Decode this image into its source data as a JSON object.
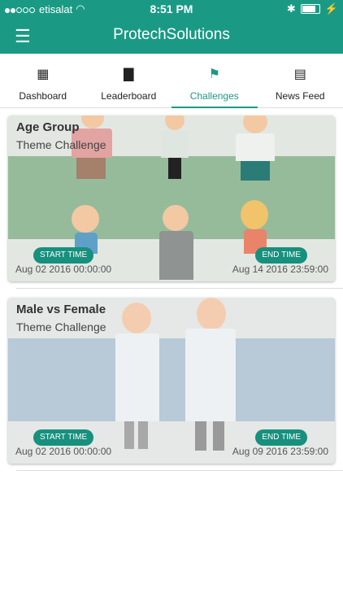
{
  "status_bar": {
    "carrier": "etisalat",
    "time": "8:51 PM"
  },
  "app": {
    "title": "ProtechSolutions"
  },
  "tabs": [
    {
      "label": "Dashboard",
      "icon": "grid-icon"
    },
    {
      "label": "Leaderboard",
      "icon": "bar-chart-icon"
    },
    {
      "label": "Challenges",
      "icon": "flag-icon"
    },
    {
      "label": "News Feed",
      "icon": "newspaper-icon"
    }
  ],
  "challenges": [
    {
      "title": "Age Group",
      "subtitle": "Theme Challenge",
      "start_label": "START TIME",
      "end_label": "END TIME",
      "start_date": "Aug 02 2016 00:00:00",
      "end_date": "Aug 14 2016 23:59:00"
    },
    {
      "title": "Male vs Female",
      "subtitle": "Theme Challenge",
      "start_label": "START TIME",
      "end_label": "END TIME",
      "start_date": "Aug 02 2016 00:00:00",
      "end_date": "Aug 09 2016 23:59:00"
    }
  ],
  "colors": {
    "primary": "#1a9a85",
    "pill": "#17907d"
  }
}
